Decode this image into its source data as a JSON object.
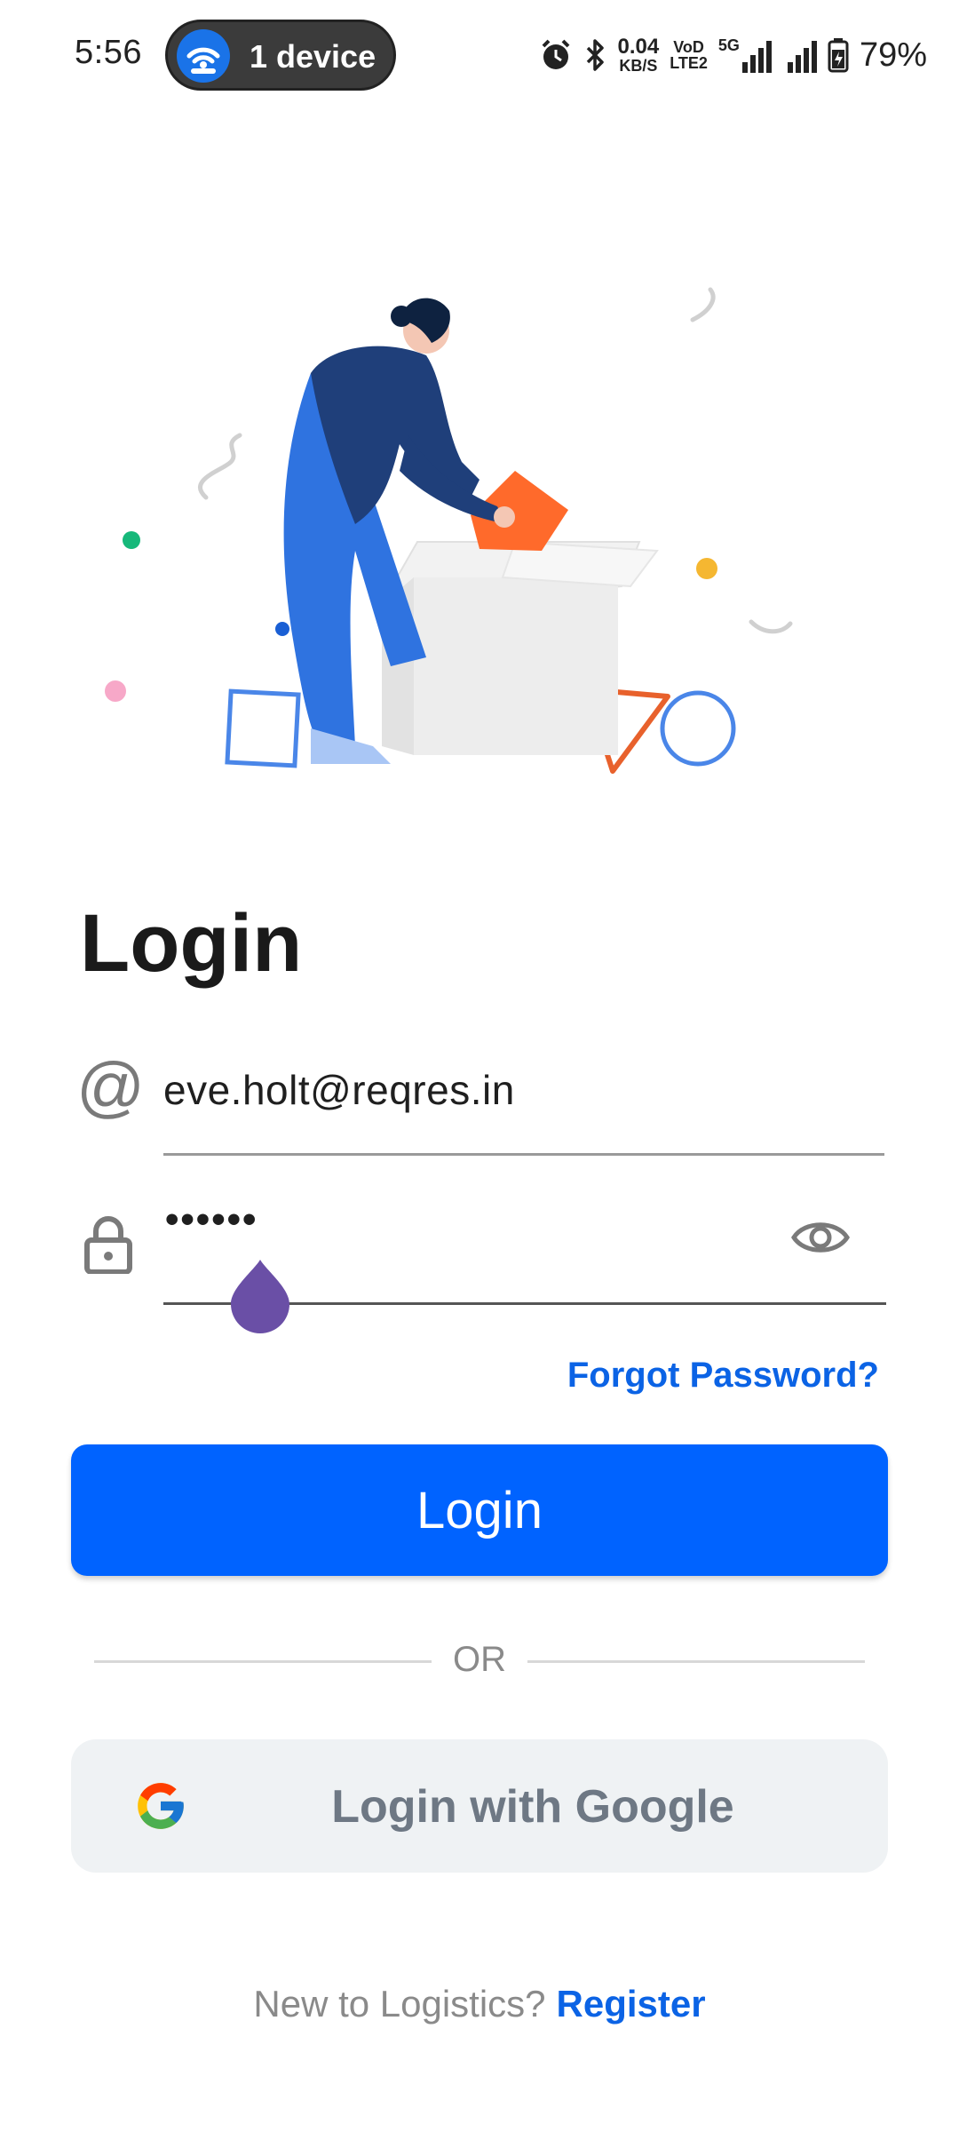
{
  "status_bar": {
    "time": "5:56",
    "device_pill": "1 device",
    "network_speed_value": "0.04",
    "network_speed_unit": "KB/S",
    "volte_top": "VoD",
    "volte_bottom": "LTE2",
    "network_type": "5G",
    "battery": "79%",
    "icons": [
      "wifi-hotspot-icon",
      "alarm-icon",
      "bluetooth-icon",
      "signal-5g-icon",
      "signal-icon",
      "battery-charging-icon"
    ]
  },
  "page": {
    "title": "Login"
  },
  "email": {
    "icon": "at-icon",
    "at_symbol": "@",
    "value": "eve.holt@reqres.in"
  },
  "password": {
    "icon": "lock-icon",
    "masked_value": "••••••",
    "toggle_icon": "eye-icon"
  },
  "forgot_password": "Forgot Password?",
  "login_button": "Login",
  "divider_text": "OR",
  "google_button": {
    "icon": "google-icon",
    "label": "Login with Google"
  },
  "register": {
    "prompt": "New to Logistics?",
    "link": "Register"
  },
  "colors": {
    "primary": "#0063ff",
    "link": "#0b63e5",
    "google_button_bg": "#eff2f4",
    "cursor_handle": "#6a4fa6"
  }
}
